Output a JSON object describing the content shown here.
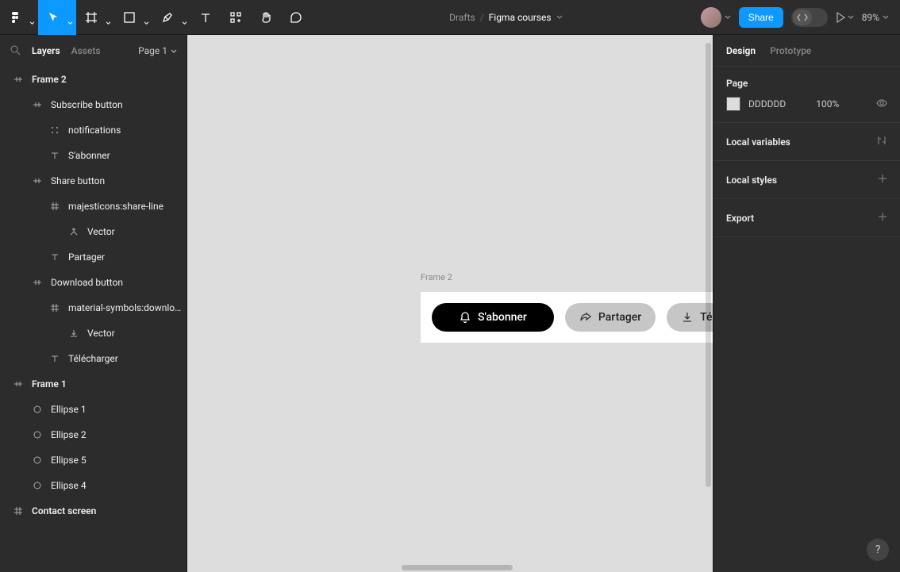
{
  "toolbar": {
    "share_label": "Share",
    "zoom": "89%"
  },
  "breadcrumb": {
    "root": "Drafts",
    "current": "Figma courses"
  },
  "left": {
    "tab_layers": "Layers",
    "tab_assets": "Assets",
    "page_selector": "Page 1",
    "tree": {
      "frame2": "Frame 2",
      "subscribe_btn": "Subscribe button",
      "notifications": "notifications",
      "sabonner": "S'abonner",
      "share_btn": "Share button",
      "share_icon": "majesticons:share-line",
      "vector1": "Vector",
      "partager": "Partager",
      "download_btn": "Download button",
      "download_icon": "material-symbols:downlo…",
      "vector2": "Vector",
      "telecharger": "Télécharger",
      "frame1": "Frame 1",
      "ellipse1": "Ellipse 1",
      "ellipse2": "Ellipse 2",
      "ellipse5": "Ellipse 5",
      "ellipse4": "Ellipse 4",
      "contact": "Contact screen"
    }
  },
  "right": {
    "tab_design": "Design",
    "tab_prototype": "Prototype",
    "page_section": "Page",
    "page_hex": "DDDDDD",
    "page_opacity": "100%",
    "local_variables": "Local variables",
    "local_styles": "Local styles",
    "export": "Export"
  },
  "canvas": {
    "frame_label": "Frame 2",
    "subscribe": "S'abonner",
    "share": "Partager",
    "download": "Télécharger"
  },
  "help": "?"
}
